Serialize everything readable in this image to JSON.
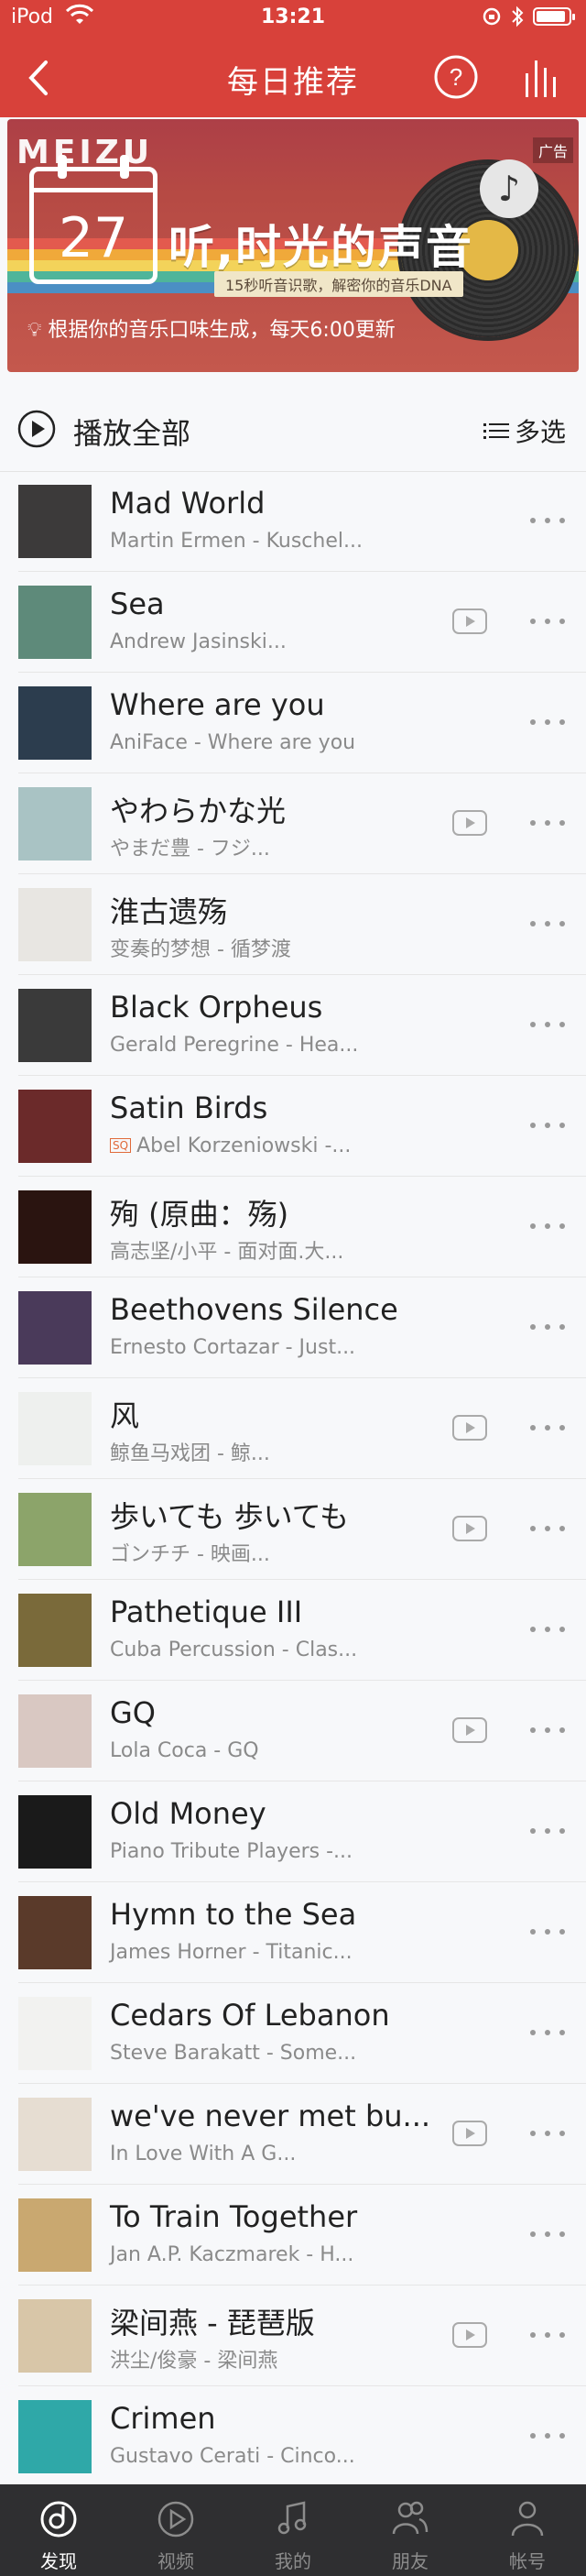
{
  "status_bar": {
    "carrier": "iPod",
    "time": "13:21",
    "battery_level": 0.9
  },
  "nav": {
    "title": "每日推荐",
    "icons": [
      "back-icon",
      "help-icon",
      "equalizer-icon"
    ]
  },
  "banner": {
    "brand": "MEIZU",
    "day": "27",
    "headline": "听,时光的声音",
    "subline": "15秒听音识歌，解密你的音乐DNA",
    "bottom_text": "根据你的音乐口味生成，每天6:00更新",
    "ad_tag": "广告"
  },
  "list_header": {
    "play_all": "播放全部",
    "multi_select": "多选"
  },
  "songs": [
    {
      "title": "Mad World",
      "subtitle": "Martin Ermen - Kuschel...",
      "mv": false,
      "sq": false,
      "cover": "#3c3a3a"
    },
    {
      "title": "Sea",
      "subtitle": "Andrew Jasinski...",
      "mv": true,
      "sq": false,
      "cover": "#5e8a7a"
    },
    {
      "title": "Where are you",
      "subtitle": "AniFace - Where are you",
      "mv": false,
      "sq": false,
      "cover": "#2c3d4e"
    },
    {
      "title": "やわらかな光",
      "subtitle": "やまだ豊 - フジ...",
      "mv": true,
      "sq": false,
      "cover": "#a9c3c4"
    },
    {
      "title": "淮古遗殇",
      "subtitle": "变奏的梦想 - 循梦渡",
      "mv": false,
      "sq": false,
      "cover": "#e8e6e2"
    },
    {
      "title": "Black Orpheus",
      "subtitle": "Gerald Peregrine - Hea...",
      "mv": false,
      "sq": false,
      "cover": "#3a3a3a"
    },
    {
      "title": "Satin Birds",
      "subtitle": "Abel Korzeniowski -...",
      "mv": false,
      "sq": true,
      "sq_label": "SQ",
      "cover": "#6b2a2a"
    },
    {
      "title": "殉 (原曲：殇)",
      "subtitle": "高志坚/小平 - 面对面.大...",
      "mv": false,
      "sq": false,
      "cover": "#2a1410"
    },
    {
      "title": "Beethovens Silence",
      "subtitle": "Ernesto Cortazar - Just...",
      "mv": false,
      "sq": false,
      "cover": "#4a3a5a"
    },
    {
      "title": "风",
      "subtitle": "鲸鱼马戏团 - 鲸...",
      "mv": true,
      "sq": false,
      "cover": "#eef0ee"
    },
    {
      "title": "歩いても 歩いても",
      "subtitle": "ゴンチチ - 映画...",
      "mv": true,
      "sq": false,
      "cover": "#8ca46a"
    },
    {
      "title": "Pathetique III",
      "subtitle": "Cuba Percussion - Clas...",
      "mv": false,
      "sq": false,
      "cover": "#7a6a3a"
    },
    {
      "title": "GQ",
      "subtitle": "Lola Coca - GQ",
      "mv": true,
      "sq": false,
      "cover": "#d9c8c2"
    },
    {
      "title": "Old Money",
      "subtitle": "Piano Tribute Players -...",
      "mv": false,
      "sq": false,
      "cover": "#1a1a1a"
    },
    {
      "title": "Hymn to the Sea",
      "subtitle": "James Horner - Titanic...",
      "mv": false,
      "sq": false,
      "cover": "#5a3a2a"
    },
    {
      "title": "Cedars Of Lebanon",
      "subtitle": "Steve Barakatt - Some...",
      "mv": false,
      "sq": false,
      "cover": "#f2f2f0"
    },
    {
      "title": "we've never met bu...",
      "subtitle": "In Love With A G...",
      "mv": true,
      "sq": false,
      "cover": "#e6ddd2"
    },
    {
      "title": "To Train Together",
      "subtitle": "Jan A.P. Kaczmarek - H...",
      "mv": false,
      "sq": false,
      "cover": "#c9a870"
    },
    {
      "title": "梁间燕 - 琵琶版",
      "subtitle": "洪尘/俊豪 - 梁间燕",
      "mv": true,
      "sq": false,
      "cover": "#d8c6a8"
    },
    {
      "title": "Crimen",
      "subtitle": "Gustavo Cerati - Cinco...",
      "mv": false,
      "sq": false,
      "cover": "#2fa8a8"
    }
  ],
  "tabs": [
    {
      "label": "发现",
      "icon": "discover-icon",
      "active": true
    },
    {
      "label": "视频",
      "icon": "video-icon",
      "active": false
    },
    {
      "label": "我的",
      "icon": "music-icon",
      "active": false
    },
    {
      "label": "朋友",
      "icon": "friends-icon",
      "active": false
    },
    {
      "label": "帐号",
      "icon": "account-icon",
      "active": false
    }
  ],
  "colors": {
    "accent": "#d8413a",
    "tabbar": "#2f2f31"
  }
}
